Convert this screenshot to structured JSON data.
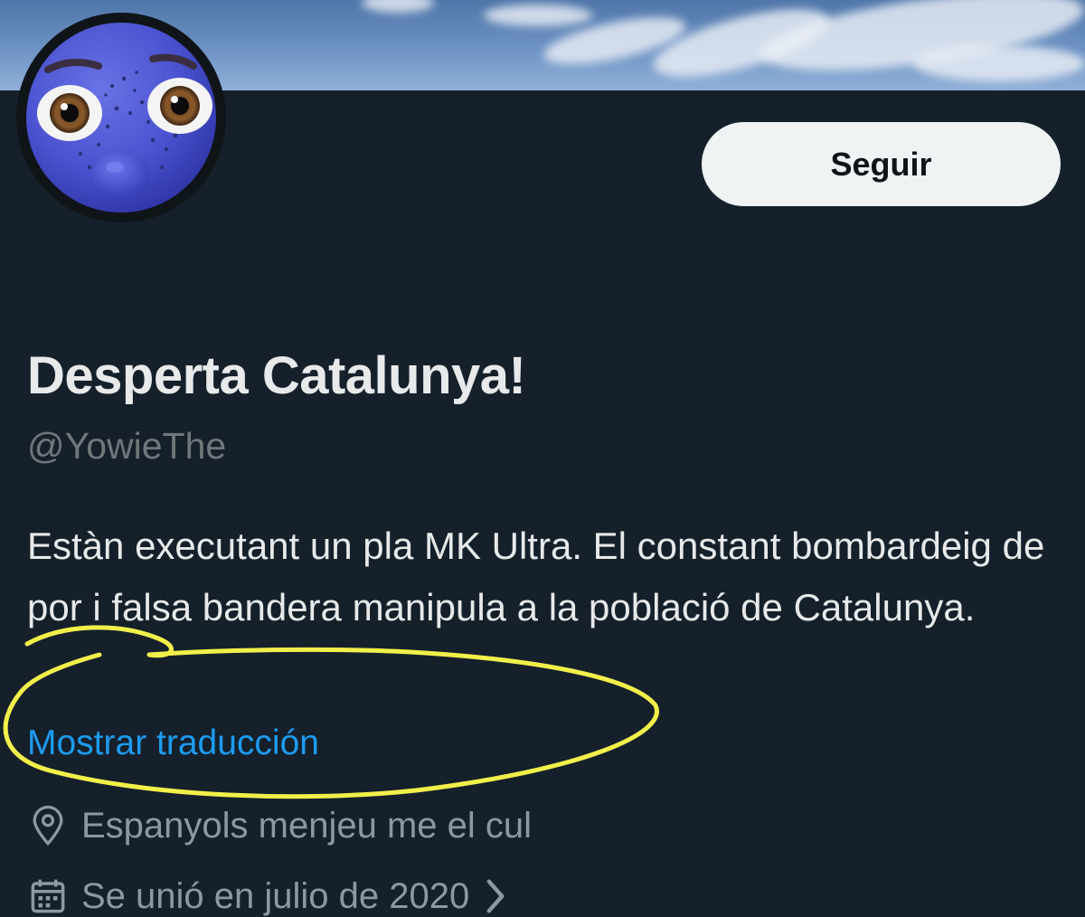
{
  "profile": {
    "display_name": "Desperta Catalunya!",
    "handle": "@YowieThe",
    "bio": "Estàn executant un pla MK Ultra. El constant bombardeig de por i falsa bandera manipula a la població de Catalunya.",
    "translate_label": "Mostrar traducción",
    "location": "Espanyols menjeu me el cul",
    "joined": "Se unió en julio de 2020"
  },
  "actions": {
    "follow_label": "Seguir"
  },
  "colors": {
    "background": "#15202b",
    "link": "#1d9bf0",
    "muted": "#71767b",
    "annotation": "#f2ef4a"
  },
  "icons": {
    "location": "location-pin-icon",
    "joined": "calendar-icon",
    "joined_more": "chevron-right-icon"
  }
}
